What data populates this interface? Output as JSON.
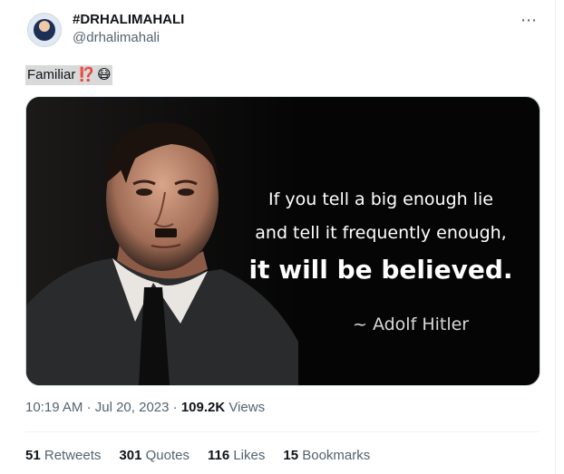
{
  "author": {
    "display_name": "#DRHALIMAHALI",
    "handle": "@drhalimahali",
    "avatar_icon": "profile-avatar"
  },
  "more_icon": "⋯",
  "tweet": {
    "text": "Familiar",
    "emoji_1": "⁉️",
    "emoji_2": "😷"
  },
  "media": {
    "line1": "If you tell a big enough lie",
    "line2": "and tell it frequently enough,",
    "line3": "it will be believed.",
    "attribution": "~ Adolf Hitler"
  },
  "meta": {
    "time": "10:19 AM",
    "sep": "·",
    "date": "Jul 20, 2023",
    "sep2": "·",
    "views_count": "109.2K",
    "views_label": "Views"
  },
  "stats": {
    "retweets_count": "51",
    "retweets_label": "Retweets",
    "quotes_count": "301",
    "quotes_label": "Quotes",
    "likes_count": "116",
    "likes_label": "Likes",
    "bookmarks_count": "15",
    "bookmarks_label": "Bookmarks"
  },
  "colors": {
    "text_primary": "#0f1419",
    "text_secondary": "#536471",
    "media_bg": "#050505"
  }
}
